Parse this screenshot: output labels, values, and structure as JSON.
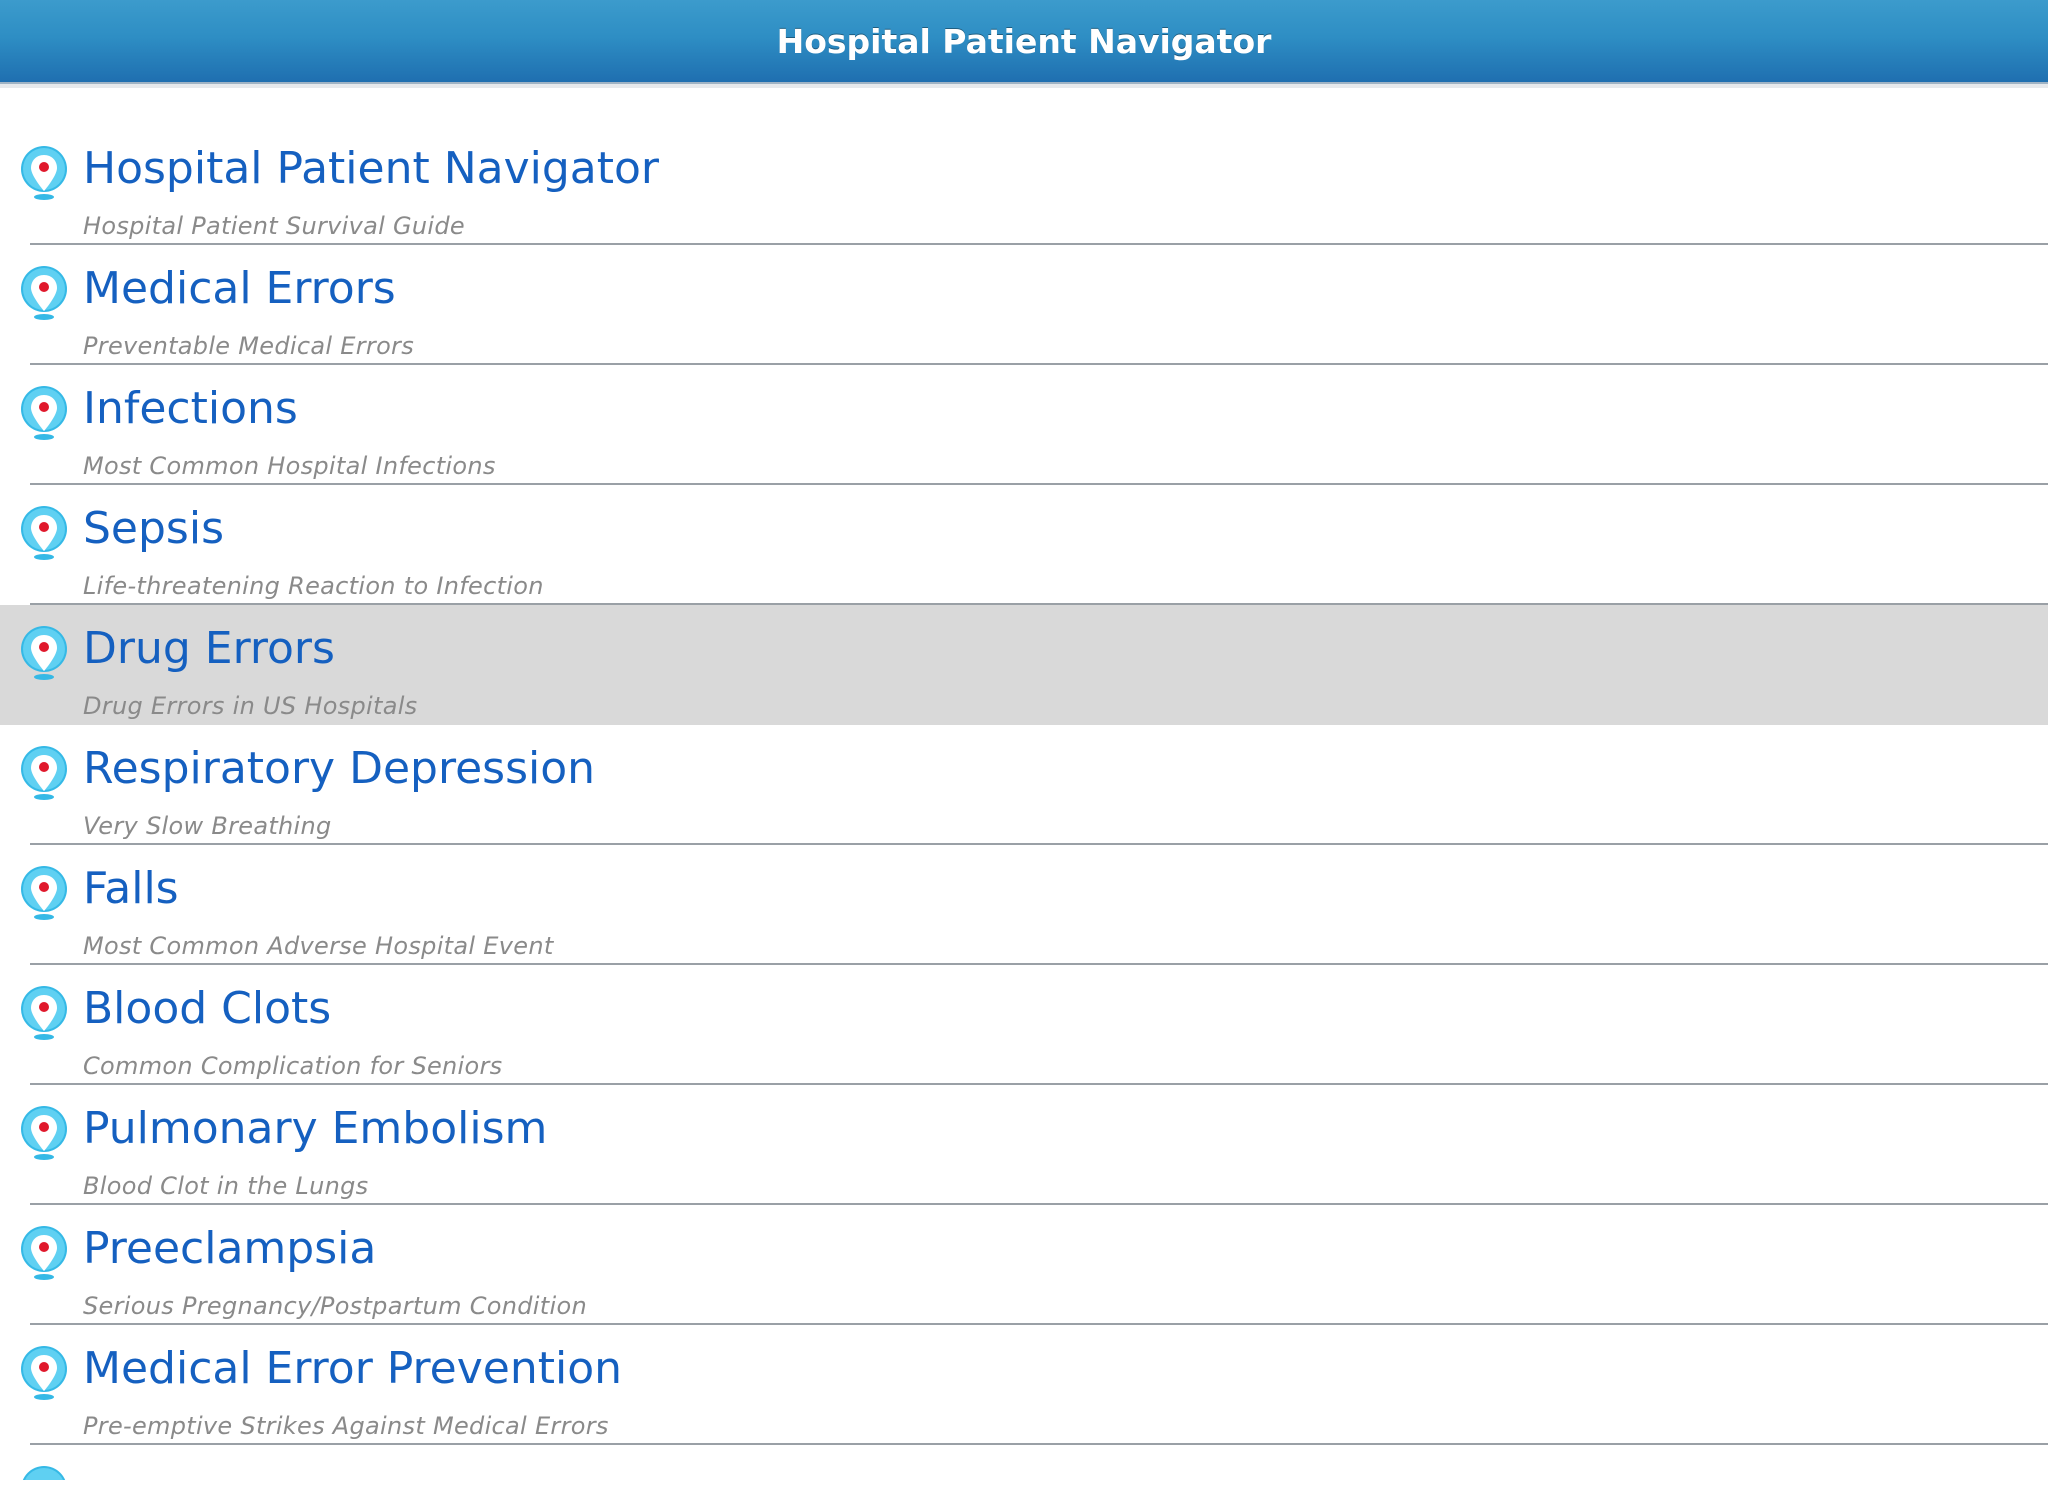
{
  "navbar": {
    "title": "Hospital Patient Navigator"
  },
  "colors": {
    "navbar_top": "#3c9bcc",
    "navbar_bottom": "#1f6fb0",
    "title_text": "#1560c0",
    "subtitle_text": "#8a8a8a",
    "selected_row": "#d9d9d9",
    "icon_outer": "#35b9e6",
    "icon_pin_dot": "#e0182c"
  },
  "list": {
    "selected_index": 4,
    "items": [
      {
        "title": "Hospital Patient Navigator",
        "subtitle": "Hospital Patient Survival Guide",
        "icon": "map-pin-icon"
      },
      {
        "title": "Medical Errors",
        "subtitle": "Preventable Medical Errors",
        "icon": "map-pin-icon"
      },
      {
        "title": "Infections",
        "subtitle": "Most Common Hospital Infections",
        "icon": "map-pin-icon"
      },
      {
        "title": "Sepsis",
        "subtitle": "Life-threatening Reaction to Infection",
        "icon": "map-pin-icon"
      },
      {
        "title": "Drug Errors",
        "subtitle": "Drug Errors in US Hospitals",
        "icon": "map-pin-icon"
      },
      {
        "title": "Respiratory Depression",
        "subtitle": "Very Slow Breathing",
        "icon": "map-pin-icon"
      },
      {
        "title": "Falls",
        "subtitle": "Most Common Adverse Hospital Event",
        "icon": "map-pin-icon"
      },
      {
        "title": "Blood Clots",
        "subtitle": "Common Complication for Seniors",
        "icon": "map-pin-icon"
      },
      {
        "title": "Pulmonary Embolism",
        "subtitle": "Blood Clot in the Lungs",
        "icon": "map-pin-icon"
      },
      {
        "title": "Preeclampsia",
        "subtitle": "Serious Pregnancy/Postpartum Condition",
        "icon": "map-pin-icon"
      },
      {
        "title": "Medical Error Prevention",
        "subtitle": "Pre-emptive Strikes Against Medical Errors",
        "icon": "map-pin-icon"
      }
    ]
  }
}
